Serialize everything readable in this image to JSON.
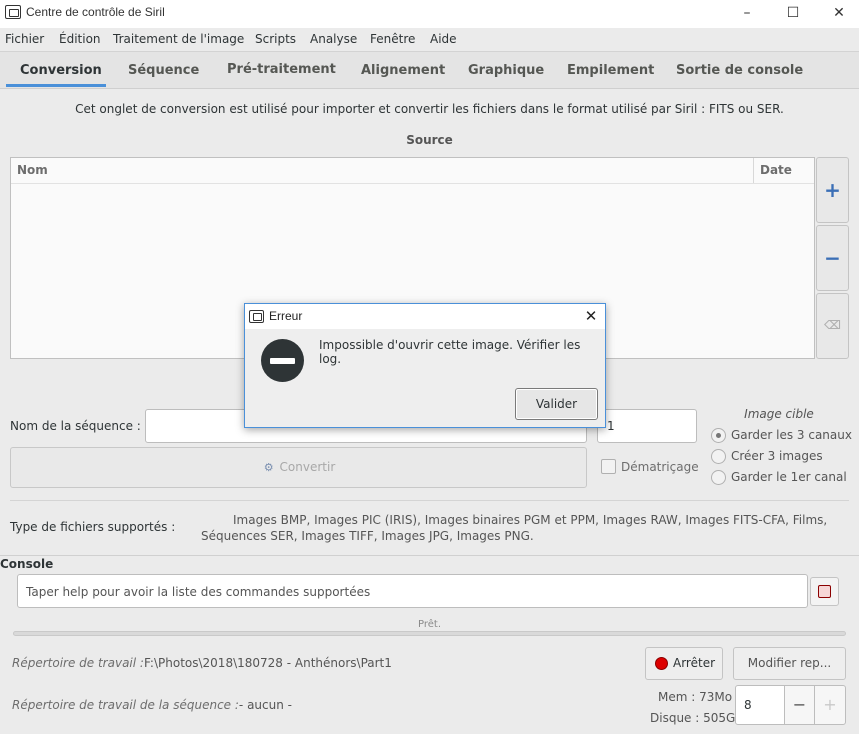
{
  "window": {
    "title": "Centre de contrôle de Siril",
    "minimize": "–",
    "maximize": "☐",
    "close": "✕"
  },
  "menu": [
    "Fichier",
    "Édition",
    "Traitement de l'image",
    "Scripts",
    "Analyse",
    "Fenêtre",
    "Aide"
  ],
  "tabs": [
    "Conversion",
    "Séquence",
    "Pré-traitement",
    "Alignement",
    "Graphique",
    "Empilement",
    "Sortie de console"
  ],
  "conversion": {
    "info": "Cet onglet de conversion est utilisé pour importer et convertir les fichiers dans le format utilisé par Siril : FITS ou SER.",
    "source_label": "Source",
    "columns": {
      "name": "Nom",
      "date": "Date"
    },
    "add_icon": "+",
    "remove_icon": "−",
    "clear_icon": "⌫",
    "sequence_name_label": "Nom de la séquence :",
    "sequence_name_value": "",
    "start_index": "1",
    "convert_label": "Convertir",
    "debayer_label": "Dématriçage",
    "target_title": "Image cible",
    "target_options": [
      "Garder les 3 canaux",
      "Créer 3 images",
      "Garder le 1er canal"
    ],
    "supported_label": "Type de fichiers supportés :",
    "supported_value": "Images BMP, Images PIC (IRIS), Images binaires PGM et PPM, Images RAW, Images FITS-CFA, Films, Séquences SER, Images TIFF, Images JPG, Images PNG."
  },
  "console": {
    "label": "Console",
    "placeholder": "Taper help pour avoir la liste des commandes supportées",
    "status": "Prêt.",
    "work_dir_label": "Répertoire de travail :",
    "work_dir_value": "F:\\Photos\\2018\\180728 - Anthénors\\Part1",
    "seq_dir_label": "Répertoire de travail de la séquence :",
    "seq_dir_value": "- aucun -",
    "stop_label": "Arrêter",
    "modify_label": "Modifier rep...",
    "mem": "Mem : 73Mo",
    "disk": "Disque : 505G",
    "threads": "8",
    "minus": "−",
    "plus": "+"
  },
  "dialog": {
    "title": "Erreur",
    "message": "Impossible d'ouvrir cette image. Vérifier les log.",
    "ok_label": "Valider",
    "close": "✕"
  },
  "colors": {
    "accent": "#4a90d9",
    "stop": "#dd0000",
    "error_icon": "#2e3436"
  }
}
